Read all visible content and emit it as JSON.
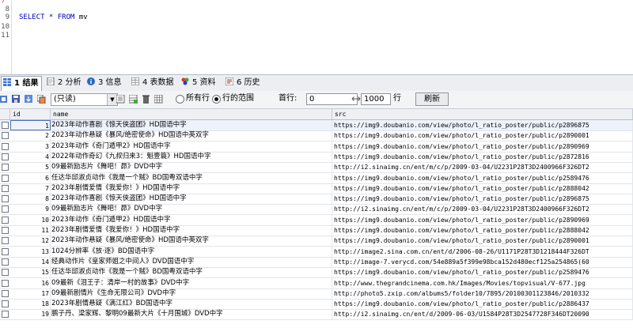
{
  "editor": {
    "lines": [
      {
        "num": "8",
        "code": ""
      },
      {
        "num": "9",
        "code_kw1": "SELECT * FROM",
        "code_rest": " mv"
      },
      {
        "num": "10",
        "code": ""
      },
      {
        "num": "11",
        "code": ""
      }
    ]
  },
  "tabs": [
    {
      "label": "1 结果",
      "active": true
    },
    {
      "label": "2 分析"
    },
    {
      "label": "3 信息"
    },
    {
      "label": "4 表数据"
    },
    {
      "label": "5 资料"
    },
    {
      "label": "6 历史"
    }
  ],
  "toolbar": {
    "mode_select": "(只读)",
    "radio_all": "所有行",
    "radio_range": "行的范围",
    "first_row_label": "首行:",
    "first_row_value": "0",
    "row_count_value": "1000",
    "rows_label": "行",
    "refresh_label": "刷新"
  },
  "grid": {
    "columns": [
      "id",
      "name",
      "src"
    ],
    "rows": [
      {
        "id": "1",
        "name": "2023年动作喜剧《惊天侠盗团》HD国语中字",
        "src": "https://img9.doubanio.com/view/photo/l_ratio_poster/public/p2896875"
      },
      {
        "id": "2",
        "name": "2023年动作悬疑《暴风/绝密使命》HD国语中英双字",
        "src": "https://img9.doubanio.com/view/photo/l_ratio_poster/public/p2890001"
      },
      {
        "id": "3",
        "name": "2023年动作《奇门遁甲2》HD国语中字",
        "src": "https://img9.doubanio.com/view/photo/l_ratio_poster/public/p2890969"
      },
      {
        "id": "4",
        "name": "2022年动作奇幻《九叔归来3：魁壹簑》HD国语中字",
        "src": "https://img9.doubanio.com/view/photo/l_ratio_poster/public/p2872816"
      },
      {
        "id": "5",
        "name": "09最新励志片《舞吧！昴》DVD中字",
        "src": "http://i2.sinaimg.cn/ent/m/c/p/2009-03-04/U2231P28T3D2400966F326DT2"
      },
      {
        "id": "6",
        "name": "任达华邱淑贞动作《我是一个贼》BD国粤双语中字",
        "src": "https://img9.doubanio.com/view/photo/l_ratio_poster/public/p2589476"
      },
      {
        "id": "7",
        "name": "2023年剧情爱情《我爱你！》HD国语中字",
        "src": "https://img9.doubanio.com/view/photo/l_ratio_poster/public/p2888042"
      },
      {
        "id": "8",
        "name": "2023年动作喜剧《惊天侠盗团》HD国语中字",
        "src": "https://img9.doubanio.com/view/photo/l_ratio_poster/public/p2896875"
      },
      {
        "id": "9",
        "name": "09最新励志片《舞吧！昴》DVD中字",
        "src": "http://i2.sinaimg.cn/ent/m/c/p/2009-03-04/U2231P28T3D2400966F326DT2"
      },
      {
        "id": "10",
        "name": "2023年动作《奇门遁甲2》HD国语中字",
        "src": "https://img9.doubanio.com/view/photo/l_ratio_poster/public/p2890969"
      },
      {
        "id": "11",
        "name": "2023年剧情爱情《我爱你！》HD国语中字",
        "src": "https://img9.doubanio.com/view/photo/l_ratio_poster/public/p2888042"
      },
      {
        "id": "12",
        "name": "2023年动作悬疑《暴风/绝密使命》HD国语中英双字",
        "src": "https://img9.doubanio.com/view/photo/l_ratio_poster/public/p2890001"
      },
      {
        "id": "13",
        "name": "1024分辨率《放·逐》BD国语中字",
        "src": "http://image2.sina.com.cn/ent/d/2006-08-26/U1171P28T3D1218444F326DT"
      },
      {
        "id": "14",
        "name": "经典动作片《皇家师姐之中间人》DVD国语中字",
        "src": "http://image-7.verycd.com/54e889a5f399e98bca152d480ecf125a254865(60"
      },
      {
        "id": "15",
        "name": "任达华邱淑贞动作《我是一个贼》BD国粤双语中字",
        "src": "https://img9.doubanio.com/view/photo/l_ratio_poster/public/p2589476"
      },
      {
        "id": "16",
        "name": "09最新《泪王子：清岸一村的故事》DVD中字",
        "src": "http://www.thegrandcinema.com.hk/Images/Movies/topvisual/V-677.jpg"
      },
      {
        "id": "17",
        "name": "09最新剧情片《生命无限公司》DVD中字",
        "src": "http://photo5.zxip.com/albums5/folder10/7895/20100301123846/2010332"
      },
      {
        "id": "18",
        "name": "2023年剧情悬疑《满江红》BD国语中字",
        "src": "https://img9.doubanio.com/view/photo/l_ratio_poster/public/p2886437"
      },
      {
        "id": "19",
        "name": "鹏子丹、梁家辉、黎明09最新大片《十月围城》DVD中字",
        "src": "http://i2.sinaimg.cn/ent/d/2009-06-03/U1584P28T3D2547728F346DT20090"
      }
    ]
  }
}
